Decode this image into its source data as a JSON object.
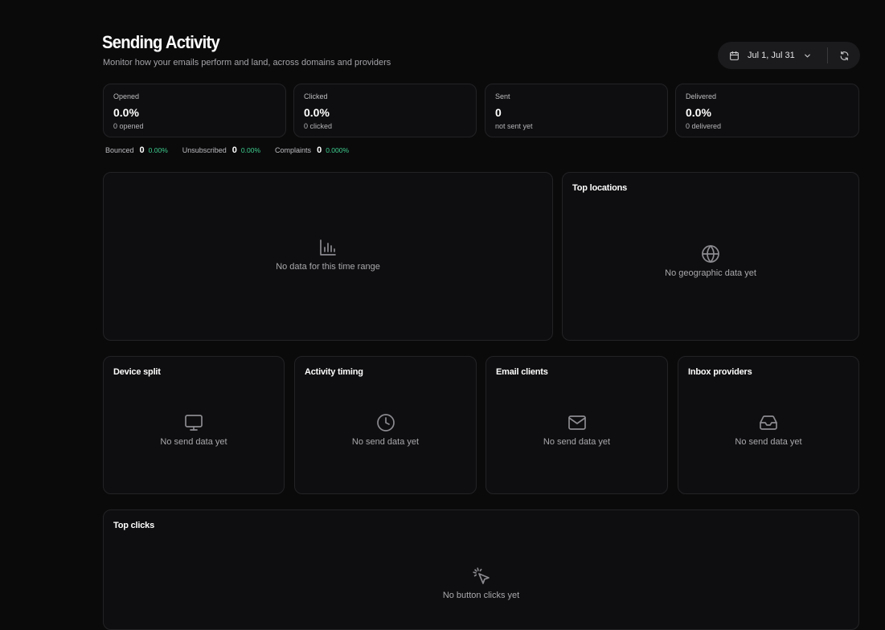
{
  "header": {
    "title": "Sending Activity",
    "subtitle": "Monitor how your emails perform and land, across domains and providers"
  },
  "controls": {
    "date_range": "Jul 1, Jul 31",
    "calendar_icon": "calendar-icon",
    "chevron_icon": "chevron-down-icon",
    "refresh_icon": "refresh-icon"
  },
  "stats": [
    {
      "label": "Opened",
      "value": "0.0%",
      "sub": "0 opened"
    },
    {
      "label": "Clicked",
      "value": "0.0%",
      "sub": "0 clicked"
    },
    {
      "label": "Sent",
      "value": "0",
      "sub": "not sent yet"
    },
    {
      "label": "Delivered",
      "value": "0.0%",
      "sub": "0 delivered"
    }
  ],
  "mini_stats": [
    {
      "label": "Bounced",
      "count": "0",
      "pct": "0.00%"
    },
    {
      "label": "Unsubscribed",
      "count": "0",
      "pct": "0.00%"
    },
    {
      "label": "Complaints",
      "count": "0",
      "pct": "0.000%"
    }
  ],
  "colors": {
    "accent_green": "#3ecf8e",
    "background": "#0a0a0b",
    "card": "#0e0e10"
  },
  "panels": {
    "activity_chart": {
      "empty_text": "No data for this time range",
      "icon": "bar-chart-icon"
    },
    "top_locations": {
      "title": "Top locations",
      "empty_text": "No geographic data yet",
      "icon": "globe-icon"
    },
    "device_split": {
      "title": "Device split",
      "empty_text": "No send data yet",
      "icon": "monitor-icon"
    },
    "activity_timing": {
      "title": "Activity timing",
      "empty_text": "No send data yet",
      "icon": "clock-icon"
    },
    "email_clients": {
      "title": "Email clients",
      "empty_text": "No send data yet",
      "icon": "mail-icon"
    },
    "inbox_providers": {
      "title": "Inbox providers",
      "empty_text": "No send data yet",
      "icon": "inbox-icon"
    },
    "top_clicks": {
      "title": "Top clicks",
      "empty_text": "No button clicks yet",
      "icon": "pointer-click-icon"
    }
  }
}
